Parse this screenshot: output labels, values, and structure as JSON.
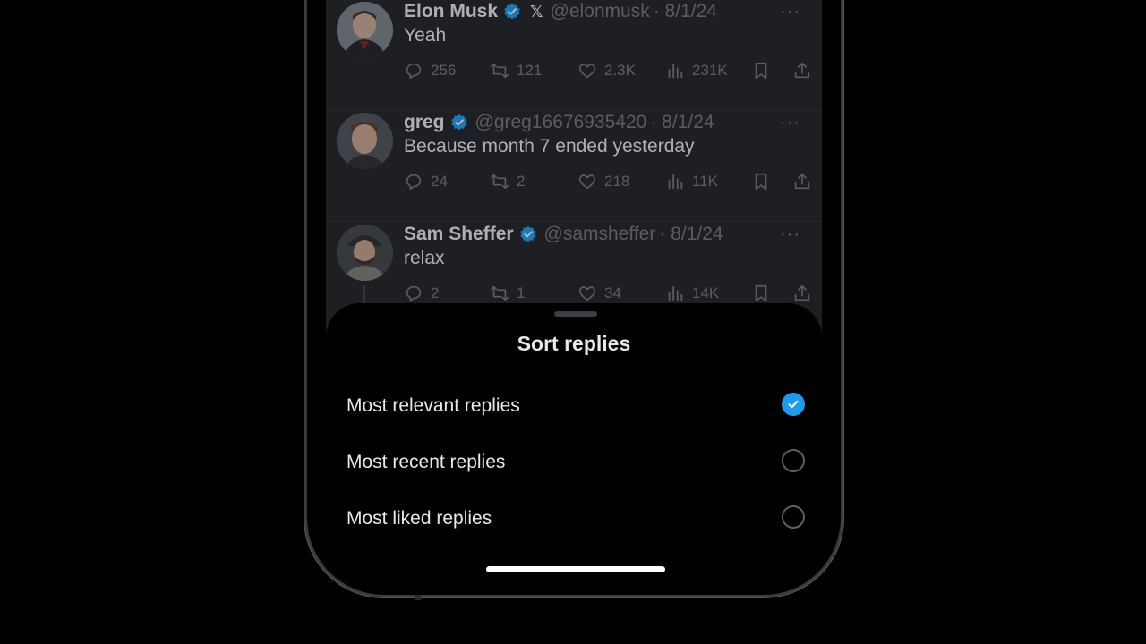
{
  "tweets": [
    {
      "name": "Elon Musk",
      "has_x_badge": true,
      "x_badge": "𝕏",
      "handle": "@elonmusk",
      "date": "· 8/1/24",
      "text": "Yeah",
      "replies": "256",
      "retweets": "121",
      "likes": "2.3K",
      "views": "231K"
    },
    {
      "name": "greg",
      "handle": "@greg16676935420",
      "date": "· 8/1/24",
      "text": "Because month 7 ended yesterday",
      "replies": "24",
      "retweets": "2",
      "likes": "218",
      "views": "11K"
    },
    {
      "name": "Sam Sheffer",
      "handle": "@samsheffer",
      "date": "· 8/1/24",
      "text": "relax",
      "replies": "2",
      "retweets": "1",
      "likes": "34",
      "views": "14K"
    }
  ],
  "more_glyph": "···",
  "sheet": {
    "title": "Sort replies",
    "options": [
      {
        "label": "Most relevant replies",
        "selected": true
      },
      {
        "label": "Most recent replies",
        "selected": false
      },
      {
        "label": "Most liked replies",
        "selected": false
      }
    ]
  },
  "colors": {
    "accent": "#1d9bf0",
    "muted_text": "#71767b",
    "background": "#000000"
  },
  "icons": {
    "reply": "reply-icon",
    "retweet": "retweet-icon",
    "like": "heart-icon",
    "views": "views-icon",
    "bookmark": "bookmark-icon",
    "share": "share-icon",
    "verified": "verified-badge-icon",
    "check": "check-icon"
  }
}
